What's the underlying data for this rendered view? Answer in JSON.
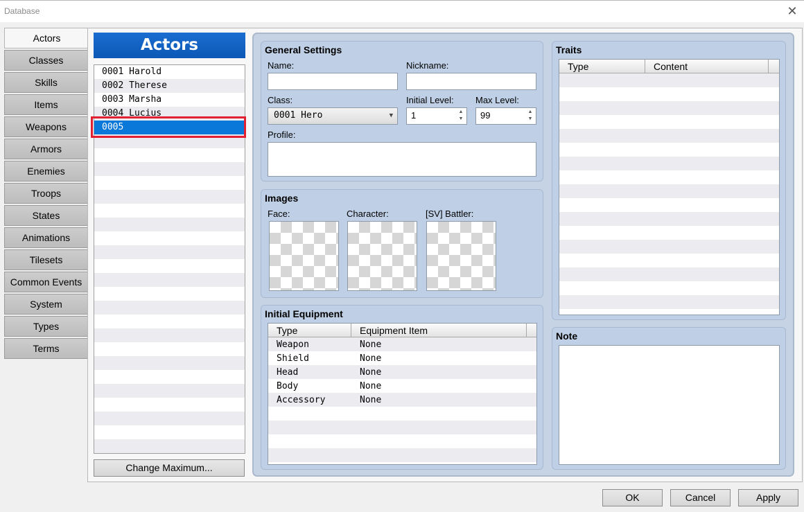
{
  "window": {
    "title": "Database"
  },
  "tabs": [
    "Actors",
    "Classes",
    "Skills",
    "Items",
    "Weapons",
    "Armors",
    "Enemies",
    "Troops",
    "States",
    "Animations",
    "Tilesets",
    "Common Events",
    "System",
    "Types",
    "Terms"
  ],
  "actor_list": {
    "header": "Actors",
    "items": [
      "0001 Harold",
      "0002 Therese",
      "0003 Marsha",
      "0004 Lucius",
      "0005"
    ],
    "selected_index": 4,
    "change_max_label": "Change Maximum..."
  },
  "general": {
    "title": "General Settings",
    "name_label": "Name:",
    "name_value": "",
    "nickname_label": "Nickname:",
    "nickname_value": "",
    "class_label": "Class:",
    "class_value": "0001 Hero",
    "initial_level_label": "Initial Level:",
    "initial_level_value": "1",
    "max_level_label": "Max Level:",
    "max_level_value": "99",
    "profile_label": "Profile:",
    "profile_value": ""
  },
  "images": {
    "title": "Images",
    "face_label": "Face:",
    "character_label": "Character:",
    "battler_label": "[SV] Battler:"
  },
  "equipment": {
    "title": "Initial Equipment",
    "col_type": "Type",
    "col_item": "Equipment Item",
    "rows": [
      {
        "type": "Weapon",
        "item": "None"
      },
      {
        "type": "Shield",
        "item": "None"
      },
      {
        "type": "Head",
        "item": "None"
      },
      {
        "type": "Body",
        "item": "None"
      },
      {
        "type": "Accessory",
        "item": "None"
      }
    ]
  },
  "traits": {
    "title": "Traits",
    "col_type": "Type",
    "col_content": "Content"
  },
  "note": {
    "title": "Note",
    "value": ""
  },
  "footer": {
    "ok": "OK",
    "cancel": "Cancel",
    "apply": "Apply"
  }
}
